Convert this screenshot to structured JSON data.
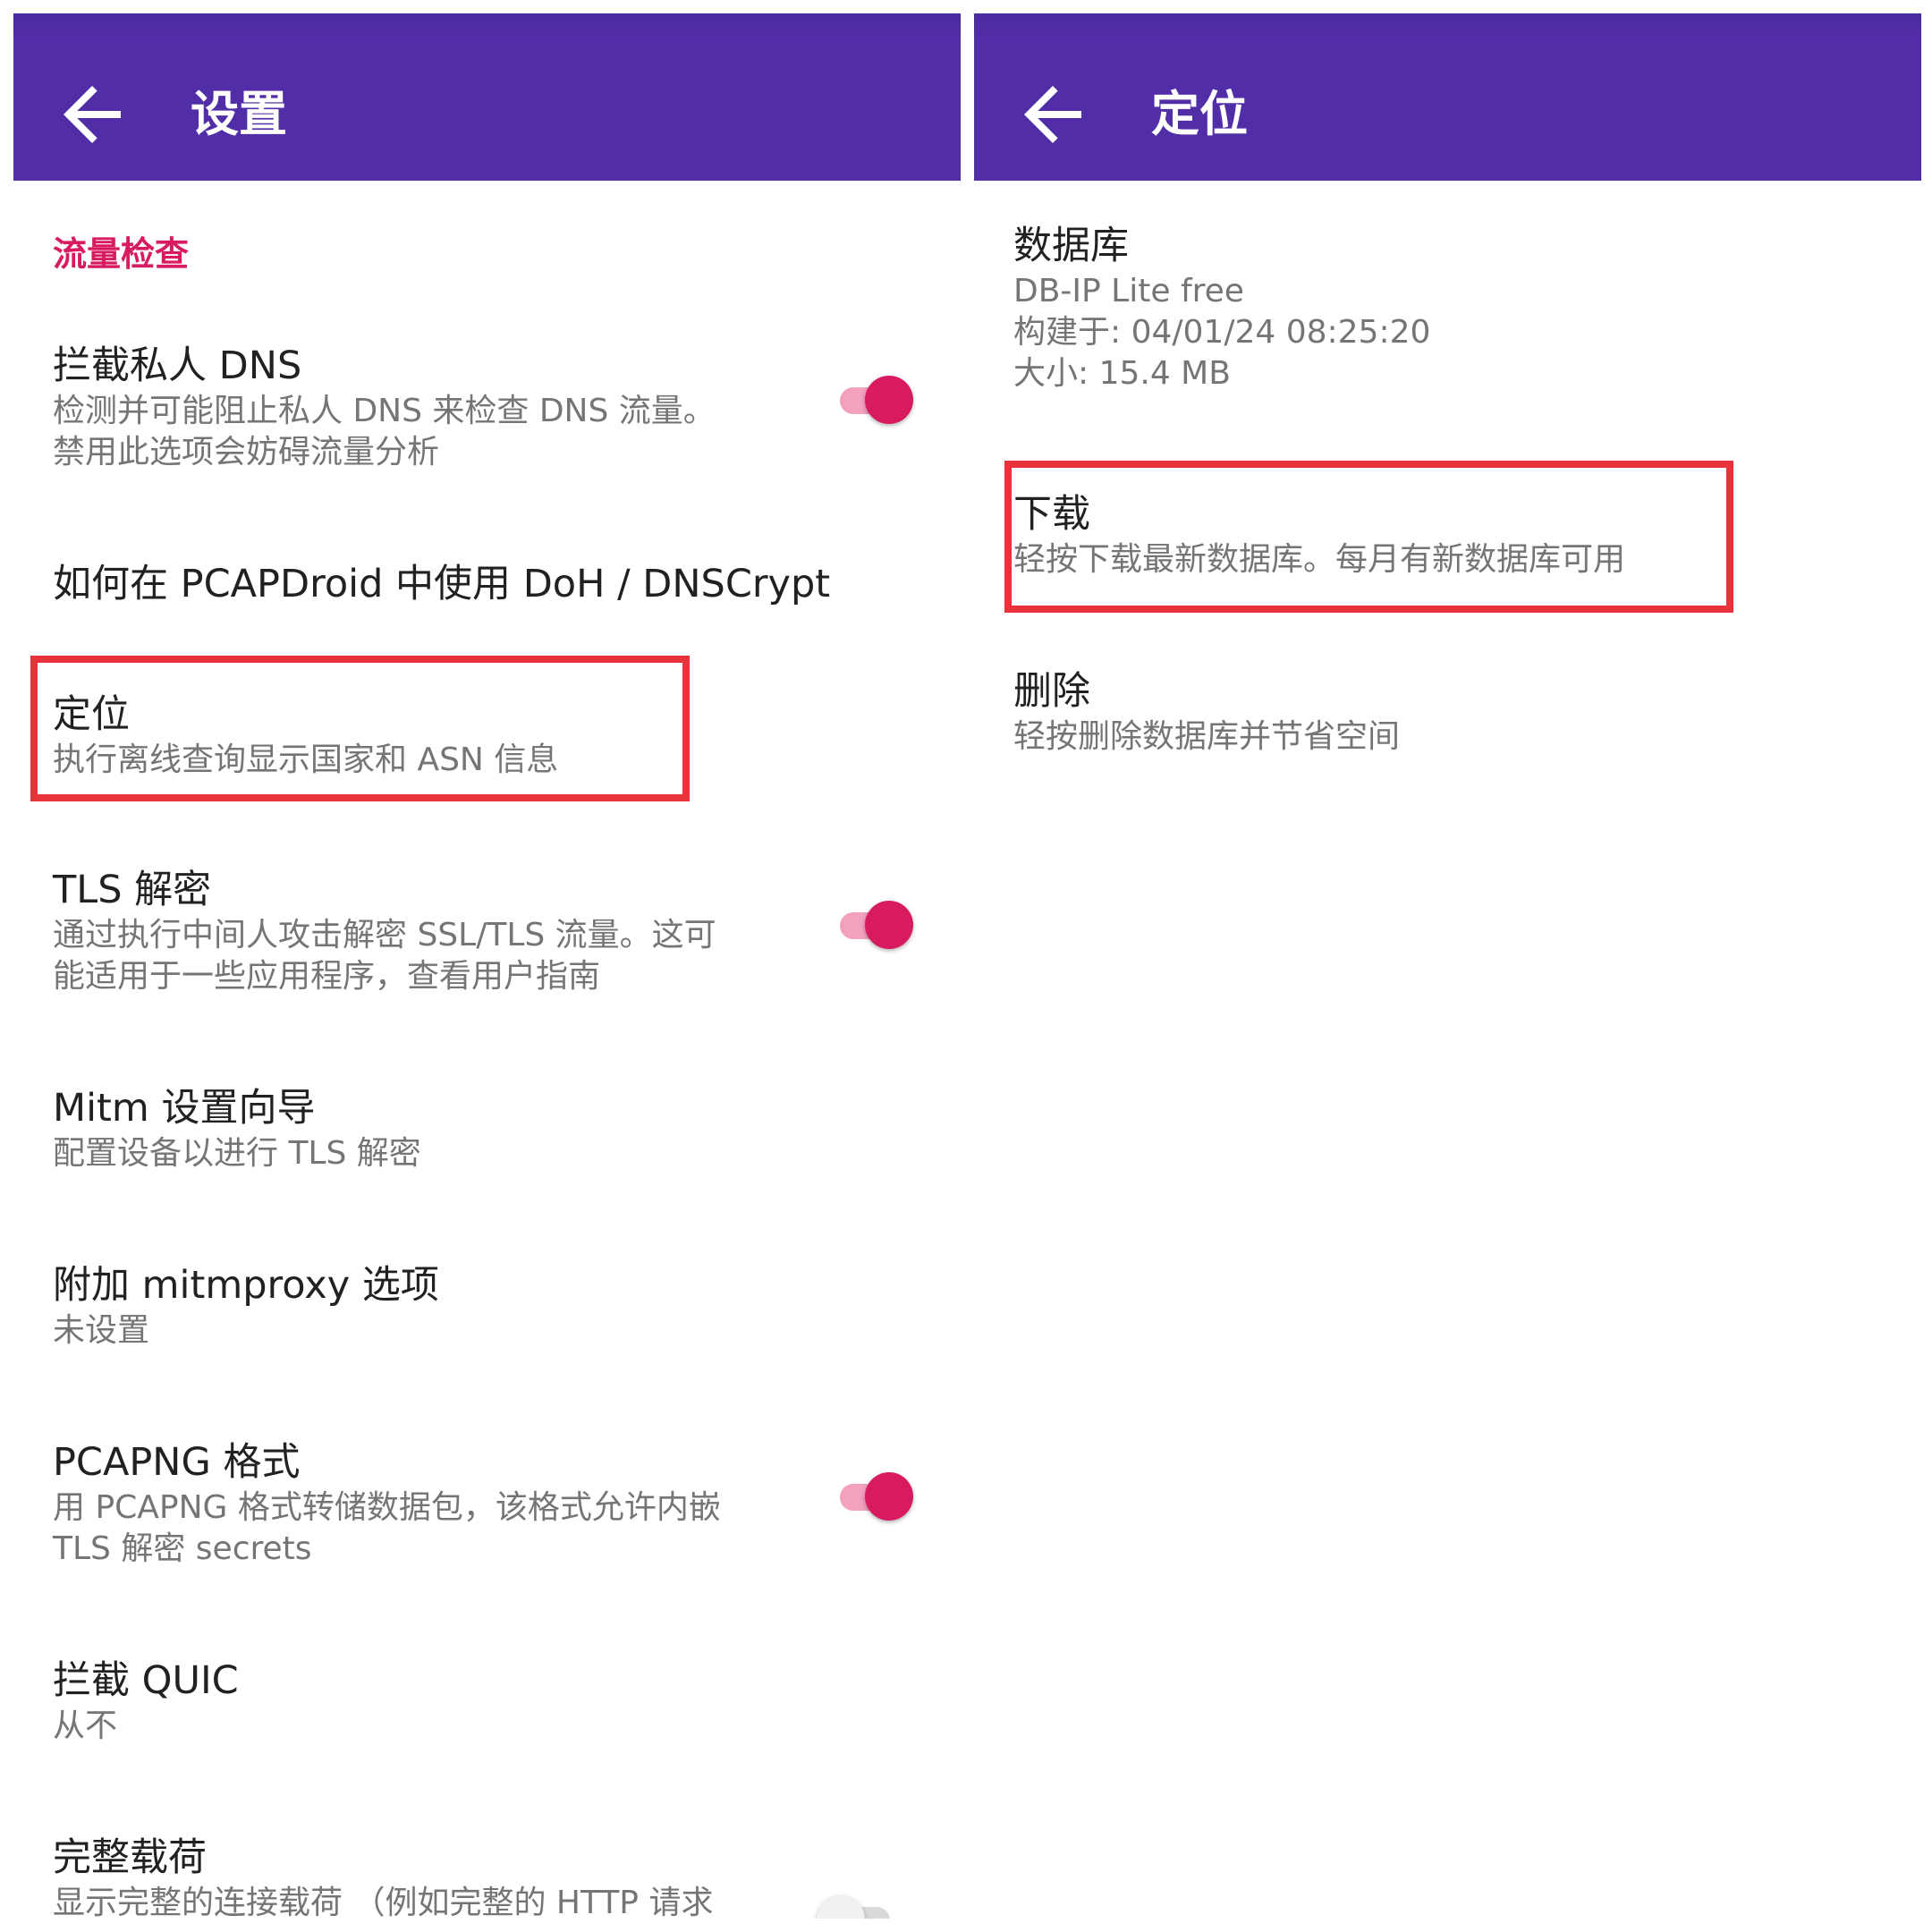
{
  "colors": {
    "appbar": "#512da8",
    "accent": "#d81b60",
    "highlight": "#e8323c"
  },
  "left": {
    "back_icon": "arrow-back-icon",
    "title": "设置",
    "category": "流量检查",
    "prefs": [
      {
        "title": "拦截私人 DNS",
        "summary": [
          "检测并可能阻止私人 DNS 来检查 DNS 流量。",
          "禁用此选项会妨碍流量分析"
        ],
        "switch": true
      },
      {
        "title": "如何在 PCAPDroid 中使用 DoH / DNSCrypt"
      },
      {
        "title": "定位",
        "summary": [
          "执行离线查询显示国家和 ASN 信息"
        ],
        "highlighted": true
      },
      {
        "title": "TLS 解密",
        "summary": [
          "通过执行中间人攻击解密 SSL/TLS 流量。这可",
          "能适用于一些应用程序，查看用户指南"
        ],
        "switch": true
      },
      {
        "title": "Mitm 设置向导",
        "summary": [
          "配置设备以进行 TLS 解密"
        ]
      },
      {
        "title": "附加 mitmproxy 选项",
        "summary": [
          "未设置"
        ]
      },
      {
        "title": "PCAPNG 格式",
        "summary": [
          "用 PCAPNG 格式转储数据包，该格式允许内嵌",
          "TLS 解密 secrets"
        ],
        "switch": true
      },
      {
        "title": "拦截 QUIC",
        "summary": [
          "从不"
        ]
      },
      {
        "title": "完整载荷",
        "summary": [
          "显示完整的连接载荷 （例如完整的 HTTP 请求"
        ],
        "switch": false
      }
    ]
  },
  "right": {
    "back_icon": "arrow-back-icon",
    "title": "定位",
    "prefs": [
      {
        "title": "数据库",
        "summary": [
          "DB-IP Lite free",
          "构建于:  04/01/24 08:25:20",
          "大小:  15.4 MB"
        ]
      },
      {
        "title": "下载",
        "summary": [
          "轻按下载最新数据库。每月有新数据库可用"
        ],
        "highlighted": true
      },
      {
        "title": "删除",
        "summary": [
          "轻按删除数据库并节省空间"
        ]
      }
    ]
  }
}
